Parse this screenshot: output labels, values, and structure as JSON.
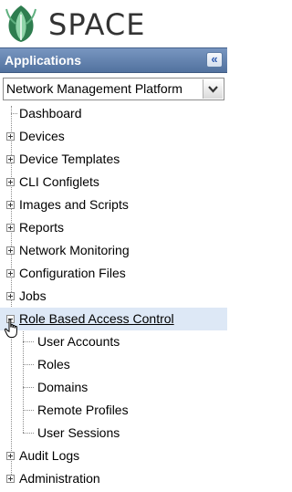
{
  "brand": {
    "name": "SPACE",
    "logo_icon": "space-leaf-logo-icon",
    "colors": {
      "leaf_dark": "#2e7d4f",
      "leaf_light": "#8fd4a8"
    }
  },
  "header": {
    "title": "Applications",
    "collapse_icon": "double-chevron-left-icon"
  },
  "app_selector": {
    "selected": "Network Management Platform",
    "arrow_icon": "chevron-down-icon"
  },
  "tree": {
    "items": [
      {
        "label": "Dashboard",
        "expander": "none"
      },
      {
        "label": "Devices",
        "expander": "plus"
      },
      {
        "label": "Device Templates",
        "expander": "plus"
      },
      {
        "label": "CLI Configlets",
        "expander": "plus"
      },
      {
        "label": "Images and Scripts",
        "expander": "plus"
      },
      {
        "label": "Reports",
        "expander": "plus"
      },
      {
        "label": "Network Monitoring",
        "expander": "plus"
      },
      {
        "label": "Configuration Files",
        "expander": "plus"
      },
      {
        "label": "Jobs",
        "expander": "plus"
      },
      {
        "label": "Role Based Access Control",
        "expander": "minus",
        "selected": true,
        "children": [
          {
            "label": "User Accounts"
          },
          {
            "label": "Roles"
          },
          {
            "label": "Domains"
          },
          {
            "label": "Remote Profiles"
          },
          {
            "label": "User Sessions"
          }
        ]
      },
      {
        "label": "Audit Logs",
        "expander": "plus"
      },
      {
        "label": "Administration",
        "expander": "plus"
      }
    ]
  },
  "colors": {
    "header_top": "#7896c0",
    "header_bottom": "#52729f",
    "selected_row": "#dde8f6"
  }
}
